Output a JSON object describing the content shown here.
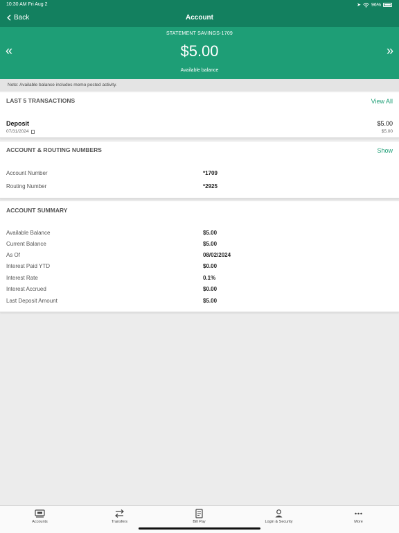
{
  "status": {
    "time": "10:30 AM   Fri Aug 2",
    "battery": "96%"
  },
  "nav": {
    "back_label": "Back",
    "title": "Account"
  },
  "account": {
    "name": "STATEMENT SAVINGS-1709",
    "balance": "$5.00",
    "balance_label": "Available balance"
  },
  "note": "Note: Available balance includes memo posted activity.",
  "transactions": {
    "title": "LAST 5 TRANSACTIONS",
    "view_all": "View All",
    "items": [
      {
        "title": "Deposit",
        "date": "07/31/2024",
        "amount": "$5.00",
        "balance": "$5.00"
      }
    ]
  },
  "routing": {
    "title": "ACCOUNT & ROUTING NUMBERS",
    "show": "Show",
    "rows": [
      {
        "label": "Account Number",
        "value": "*1709"
      },
      {
        "label": "Routing Number",
        "value": "*2925"
      }
    ]
  },
  "summary": {
    "title": "ACCOUNT SUMMARY",
    "rows": [
      {
        "label": "Available Balance",
        "value": "$5.00"
      },
      {
        "label": "Current Balance",
        "value": "$5.00"
      },
      {
        "label": "As Of",
        "value": "08/02/2024"
      },
      {
        "label": "Interest Paid YTD",
        "value": "$0.00"
      },
      {
        "label": "Interest Rate",
        "value": "0.1%"
      },
      {
        "label": "Interest Accrued",
        "value": "$0.00"
      },
      {
        "label": "Last Deposit Amount",
        "value": "$5.00"
      }
    ]
  },
  "tabs": [
    {
      "label": "Accounts",
      "icon": "accounts-icon"
    },
    {
      "label": "Transfers",
      "icon": "transfers-icon"
    },
    {
      "label": "Bill Pay",
      "icon": "bill-pay-icon"
    },
    {
      "label": "Login & Security",
      "icon": "user-icon"
    },
    {
      "label": "More",
      "icon": "more-icon"
    }
  ],
  "colors": {
    "accent": "#1e9e76",
    "header_dark": "#13805f",
    "background": "#ececec"
  }
}
